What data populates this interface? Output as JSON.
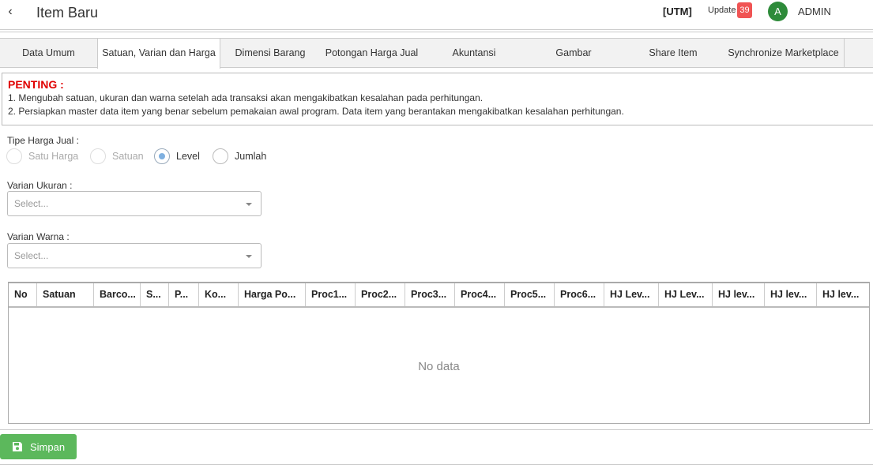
{
  "header": {
    "back_glyph": "‹",
    "title": "Item Baru",
    "utm": "[UTM]",
    "update_label": "Update",
    "update_count": "39",
    "avatar_initial": "A",
    "user": "ADMIN"
  },
  "tabs": [
    {
      "label": "Data Umum"
    },
    {
      "label": "Satuan, Varian dan Harga"
    },
    {
      "label": "Dimensi Barang"
    },
    {
      "label": "Potongan Harga Jual"
    },
    {
      "label": "Akuntansi"
    },
    {
      "label": "Gambar"
    },
    {
      "label": "Share Item"
    },
    {
      "label": "Synchronize Marketplace"
    }
  ],
  "notice": {
    "title": "PENTING :",
    "lines": [
      "1. Mengubah satuan, ukuran dan warna setelah ada transaksi akan mengakibatkan kesalahan pada perhitungan.",
      "2. Persiapkan master data item yang benar sebelum pemakaian awal program. Data item yang berantakan mengakibatkan kesalahan perhitungan."
    ]
  },
  "form": {
    "price_type_label": "Tipe Harga Jual :",
    "price_type_options": [
      {
        "label": "Satu Harga"
      },
      {
        "label": "Satuan"
      },
      {
        "label": "Level"
      },
      {
        "label": "Jumlah"
      }
    ],
    "size_variant_label": "Varian Ukuran :",
    "size_variant_placeholder": "Select...",
    "color_variant_label": "Varian Warna :",
    "color_variant_placeholder": "Select..."
  },
  "table": {
    "columns": [
      "No",
      "Satuan",
      "Barco...",
      "S...",
      "P...",
      "Ko...",
      "Harga Po...",
      "Proc1...",
      "Proc2...",
      "Proc3...",
      "Proc4...",
      "Proc5...",
      "Proc6...",
      "HJ Lev...",
      "HJ Lev...",
      "HJ lev...",
      "HJ lev...",
      "HJ lev..."
    ],
    "empty_text": "No data"
  },
  "footer": {
    "save_label": "Simpan"
  },
  "colors": {
    "accent_green": "#5cb85c",
    "badge_red": "#f05454",
    "warning_red": "#e00000",
    "avatar_green": "#2e8b3a"
  }
}
